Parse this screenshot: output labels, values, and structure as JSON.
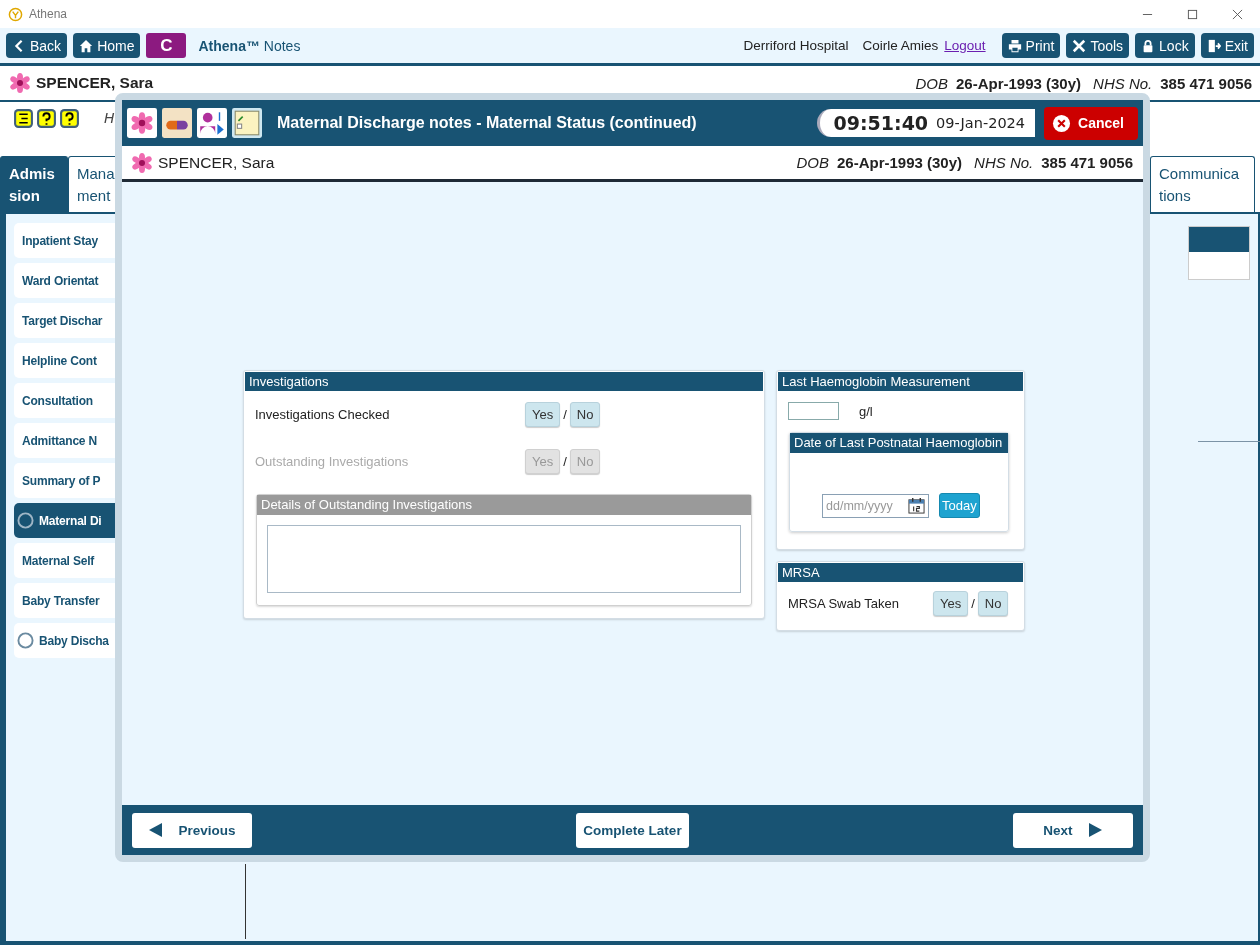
{
  "window": {
    "title": "Athena"
  },
  "toolbar": {
    "left_buttons": [
      {
        "label": "Back",
        "kind": "back"
      },
      {
        "label": "Home",
        "kind": "home"
      }
    ],
    "c_button": "C",
    "app_name": "**Athena™** Notes",
    "location": "Derriford Hospital",
    "user": "Coirle Amies",
    "logout": "Logout",
    "right_buttons": [
      {
        "label": "Print",
        "kind": "print"
      },
      {
        "label": "Tools",
        "kind": "tools"
      },
      {
        "label": "Lock",
        "kind": "lock"
      },
      {
        "label": "Exit",
        "kind": "exit"
      }
    ]
  },
  "patient": {
    "name": "SPENCER, Sara",
    "dob_label": "DOB",
    "dob": "26-Apr-1993 (30y)",
    "nhs_label": "NHS No.",
    "nhs": "385 471 9056"
  },
  "header_text": "H",
  "tabs": [
    {
      "label": "Admis sion",
      "selected": true
    },
    {
      "label": "Mana ment",
      "selected": false
    },
    {
      "label": "Communica tions",
      "selected": false
    }
  ],
  "sidebar": {
    "items": [
      {
        "label": "Inpatient Stay",
        "kind": "plain",
        "selected": false
      },
      {
        "label": "Ward Orientat",
        "kind": "plain",
        "selected": false
      },
      {
        "label": "Target Dischar",
        "kind": "plain",
        "selected": false
      },
      {
        "label": "Helpline Cont",
        "kind": "plain",
        "selected": false
      },
      {
        "label": "Consultation",
        "kind": "plain",
        "selected": false
      },
      {
        "label": "Admittance N",
        "kind": "plain",
        "selected": false
      },
      {
        "label": "Summary of P",
        "kind": "plain",
        "selected": false
      },
      {
        "label": "Maternal Di",
        "kind": "radio",
        "selected": true
      },
      {
        "label": "Maternal Self",
        "kind": "plain",
        "selected": false
      },
      {
        "label": "Baby Transfer",
        "kind": "plain",
        "selected": false
      },
      {
        "label": "Baby Discha",
        "kind": "radio",
        "selected": false
      }
    ]
  },
  "dialog": {
    "icons": [
      {
        "kind": "flower"
      },
      {
        "kind": "pill"
      },
      {
        "kind": "person"
      },
      {
        "kind": "note"
      }
    ],
    "title": "Maternal Discharge notes - Maternal Status (continued)",
    "time": "09:51:40",
    "date": "09-Jan-2024",
    "cancel": "Cancel",
    "patient": {
      "name": "SPENCER, Sara",
      "dob_label": "DOB",
      "dob": "26-Apr-1993 (30y)",
      "nhs_label": "NHS No.",
      "nhs": "385 471 9056"
    },
    "investigations": {
      "title": "Investigations",
      "rows": [
        {
          "label": "Investigations Checked",
          "disabled": false,
          "separator": "/",
          "options": [
            {
              "label": "Yes",
              "selected": false
            },
            {
              "label": "No",
              "selected": false
            }
          ]
        },
        {
          "label": "Outstanding Investigations",
          "disabled": true,
          "separator": "/",
          "options": [
            {
              "label": "Yes",
              "selected": false
            },
            {
              "label": "No",
              "selected": false
            }
          ]
        }
      ],
      "details": {
        "title": "Details of Outstanding Investigations",
        "disabled": true
      }
    },
    "haemoglobin": {
      "title": "Last Haemoglobin Measurement",
      "unit": "g/l",
      "date_box": {
        "title": "Date of Last Postnatal Haemoglobin",
        "placeholder": "dd/mm/yyyy",
        "today": "Today"
      }
    },
    "mrsa": {
      "title": "MRSA",
      "rows": [
        {
          "label": "MRSA Swab Taken",
          "disabled": false,
          "separator": "/",
          "options": [
            {
              "label": "Yes",
              "selected": false
            },
            {
              "label": "No",
              "selected": false
            }
          ]
        }
      ]
    },
    "footer": {
      "previous": "Previous",
      "complete_later": "Complete Later",
      "next": "Next"
    }
  }
}
